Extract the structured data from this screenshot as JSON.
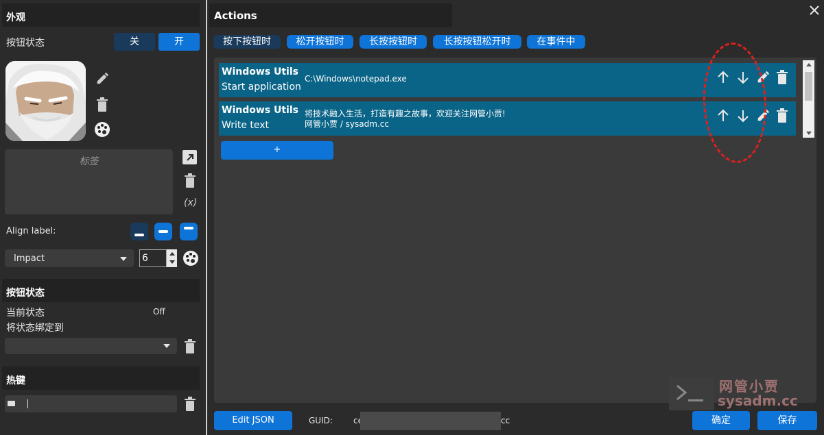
{
  "left": {
    "appearance_title": "外观",
    "button_state_label": "按钮状态",
    "toggle_off": "关",
    "toggle_on": "开",
    "label_placeholder": "标签",
    "variable_symbol": "(x)",
    "align_label": "Align label:",
    "font_name": "Impact",
    "font_size": "6",
    "state_section_title": "按钮状态",
    "current_state_label": "当前状态",
    "current_state_value": "Off",
    "bind_state_label": "将状态绑定到",
    "hotkey_section_title": "热键"
  },
  "actions": {
    "title": "Actions",
    "tabs": [
      "按下按钮时",
      "松开按钮时",
      "长按按钮时",
      "长按按钮松开时",
      "在事件中"
    ],
    "items": [
      {
        "title": "Windows Utils",
        "subtitle": "Start application",
        "detail_line1": "C:\\Windows\\notepad.exe",
        "detail_line2": ""
      },
      {
        "title": "Windows Utils",
        "subtitle": "Write text",
        "detail_line1": "将技术融入生活，打造有趣之故事，欢迎关注网管小贾!",
        "detail_line2": "网管小贾 / sysadm.cc"
      }
    ],
    "add_label": "+"
  },
  "footer": {
    "edit_json": "Edit JSON",
    "guid_label": "GUID:",
    "guid_prefix": "ce",
    "guid_suffix": "cc",
    "ok": "确定",
    "save": "保存"
  },
  "watermark": {
    "line1": "网管小贾",
    "line2": "sysadm.cc"
  },
  "colors": {
    "accent": "#0f74d8",
    "row_bg": "#0a6487",
    "annotation": "#e0201e"
  }
}
